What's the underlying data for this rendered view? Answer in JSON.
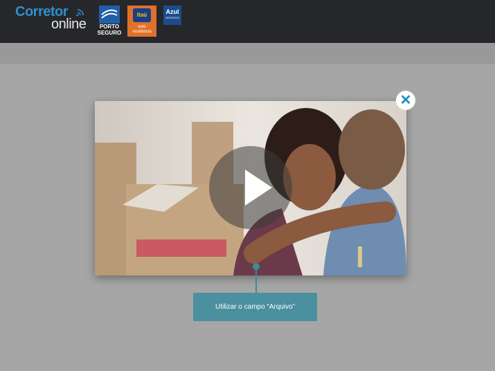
{
  "header": {
    "logo_part1": "Corretor",
    "logo_part2": "online",
    "partners": [
      {
        "name": "porto-seguro",
        "line1": "PORTO",
        "line2": "SEGURO"
      },
      {
        "name": "itau",
        "badge": "Itaú",
        "line1": "auto",
        "line2": "residência"
      },
      {
        "name": "azul",
        "label": "Azul",
        "sub": "SEGUROS"
      }
    ]
  },
  "video": {
    "play_icon": "play-icon"
  },
  "modal": {
    "close_icon": "close-icon",
    "close_glyph": "✕"
  },
  "tooltip": {
    "text": "Utilizar o campo “Arquivo”"
  },
  "colors": {
    "topbar": "#26272b",
    "accent": "#2f8fcf",
    "tooltip": "#4b909e"
  }
}
